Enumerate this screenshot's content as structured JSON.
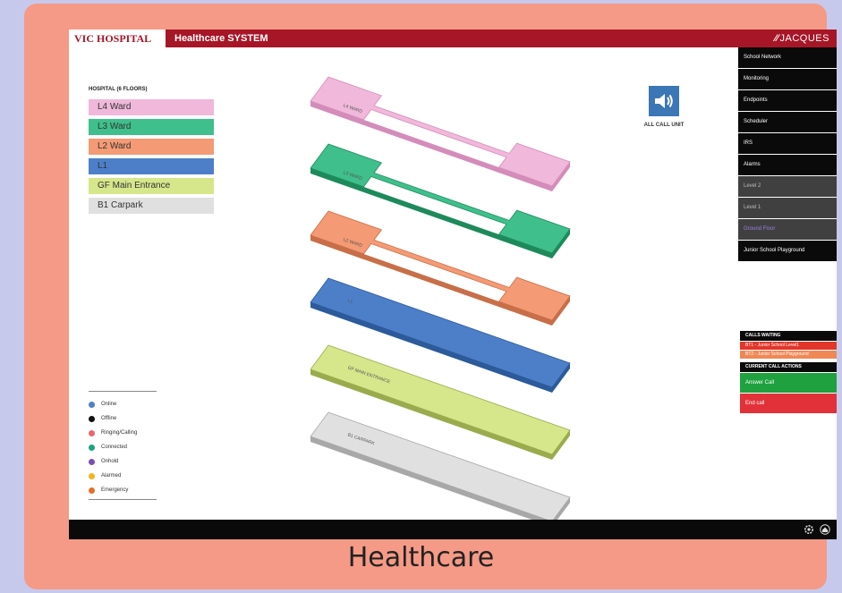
{
  "header": {
    "brand": "VIC HOSPITAL",
    "system_title": "Healthcare SYSTEM",
    "logo": "JACQUES"
  },
  "floors_legend": {
    "title": "HOSPITAL (6 FLOORS)",
    "items": [
      {
        "label": "L4 Ward",
        "color": "#f0b8da"
      },
      {
        "label": "L3 Ward",
        "color": "#3fbf8b"
      },
      {
        "label": "L2 Ward",
        "color": "#f49a74"
      },
      {
        "label": "L1",
        "color": "#4d7fc9"
      },
      {
        "label": "GF Main Entrance",
        "color": "#d6e68b"
      },
      {
        "label": "B1 Carpark",
        "color": "#e0e0e0"
      }
    ]
  },
  "status_legend": [
    {
      "label": "Online",
      "color": "#4f81c6"
    },
    {
      "label": "Offline",
      "color": "#111111"
    },
    {
      "label": "Ringing/Calling",
      "color": "#e8686b"
    },
    {
      "label": "Connected",
      "color": "#1aa37c"
    },
    {
      "label": "Onhold",
      "color": "#7a4fb2"
    },
    {
      "label": "Alarmed",
      "color": "#f2b41d"
    },
    {
      "label": "Emergency",
      "color": "#e56f25"
    }
  ],
  "all_call": {
    "label": "ALL CALL UNIT",
    "icon": "speaker-icon"
  },
  "menu": [
    {
      "label": "School Network",
      "style": "dark"
    },
    {
      "label": "Monitoring",
      "style": "dark"
    },
    {
      "label": "Endpoints",
      "style": "dark"
    },
    {
      "label": "Scheduler",
      "style": "dark"
    },
    {
      "label": "IRS",
      "style": "dark"
    },
    {
      "label": "Alarms",
      "style": "dark"
    },
    {
      "label": "Level 2",
      "style": "grey"
    },
    {
      "label": "Level 1",
      "style": "grey"
    },
    {
      "label": "Ground Floor",
      "style": "selected"
    },
    {
      "label": "Junior School Playground",
      "style": "dark"
    }
  ],
  "calls": {
    "waiting_title": "CALLS WAITING",
    "waiting": [
      "BT1 - Junior School Level1",
      "BT2 - Junior School Playground"
    ],
    "actions_title": "CURRENT CALL ACTIONS",
    "answer": "Answer Call",
    "end": "End call"
  },
  "building": {
    "floors": [
      {
        "label": "L4 WARD",
        "color": "#f0b8da",
        "edge": "#d48cba"
      },
      {
        "label": "L3 WARD",
        "color": "#3fbf8b",
        "edge": "#1e8a5c"
      },
      {
        "label": "L2 WARD",
        "color": "#f49a74",
        "edge": "#c86e48"
      },
      {
        "label": "L1",
        "color": "#4d7fc9",
        "edge": "#2c5a9a"
      },
      {
        "label": "GF MAIN ENTRANCE",
        "color": "#d6e68b",
        "edge": "#9aab4e"
      },
      {
        "label": "B1 CARPARK",
        "color": "#e0e0e0",
        "edge": "#a8a8a8"
      }
    ]
  },
  "footer": {
    "icons": [
      "settings-icon",
      "home-icon"
    ]
  },
  "caption": "Healthcare"
}
